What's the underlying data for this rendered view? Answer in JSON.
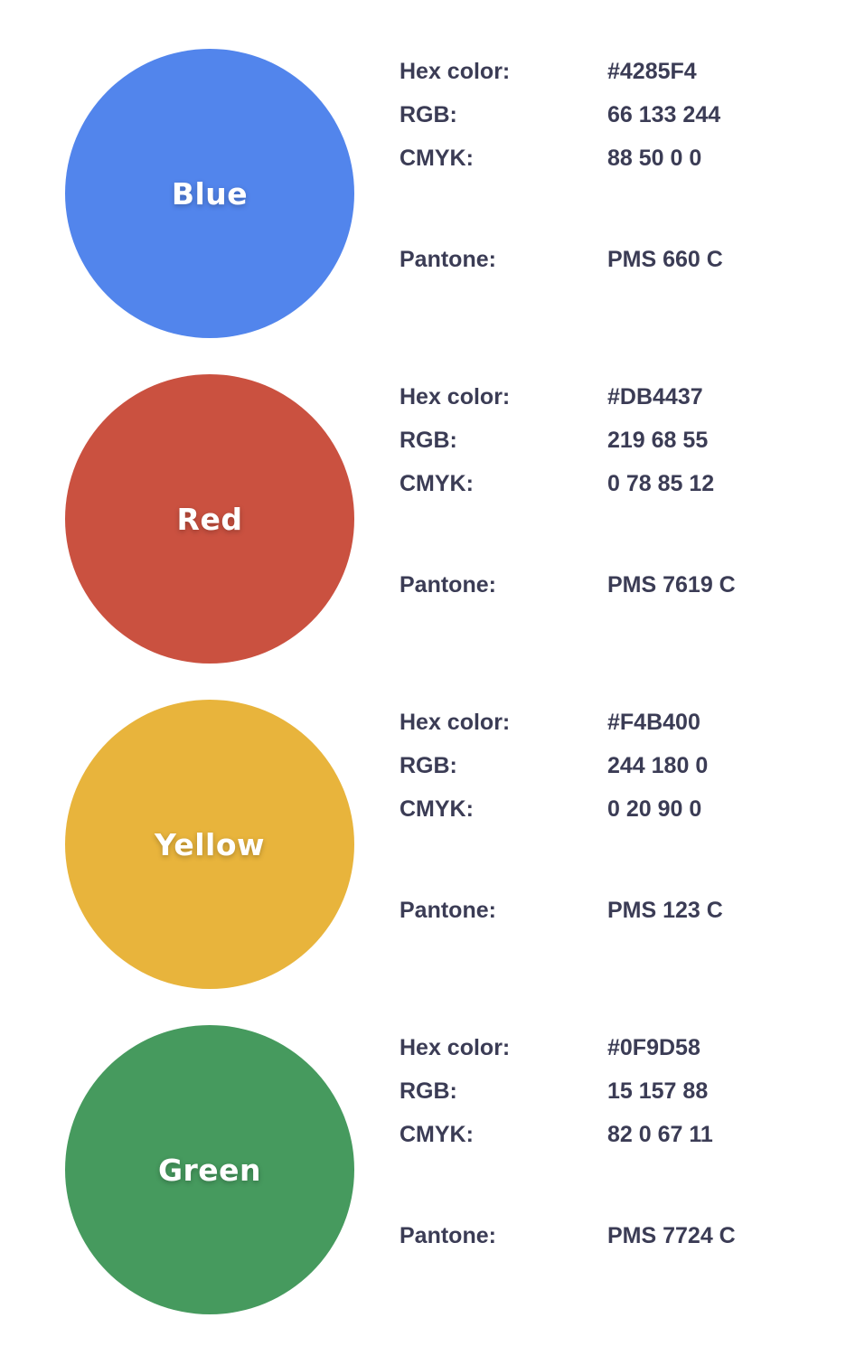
{
  "labels": {
    "hex": "Hex color:",
    "rgb": "RGB:",
    "cmyk": "CMYK:",
    "pantone": "Pantone:"
  },
  "colors": [
    {
      "name": "Blue",
      "swatch_hex": "#5285EC",
      "hex": "#4285F4",
      "rgb": "66 133 244",
      "cmyk": "88 50 0 0",
      "pantone": "PMS 660 C"
    },
    {
      "name": "Red",
      "swatch_hex": "#CA5140",
      "hex": "#DB4437",
      "rgb": "219 68 55",
      "cmyk": "0 78 85 12",
      "pantone": "PMS 7619 C"
    },
    {
      "name": "Yellow",
      "swatch_hex": "#E8B43C",
      "hex": "#F4B400",
      "rgb": "244 180 0",
      "cmyk": "0 20 90 0",
      "pantone": "PMS 123 C"
    },
    {
      "name": "Green",
      "swatch_hex": "#469A5E",
      "hex": "#0F9D58",
      "rgb": "15 157 88",
      "cmyk": "82 0 67 11",
      "pantone": "PMS 7724 C"
    }
  ]
}
